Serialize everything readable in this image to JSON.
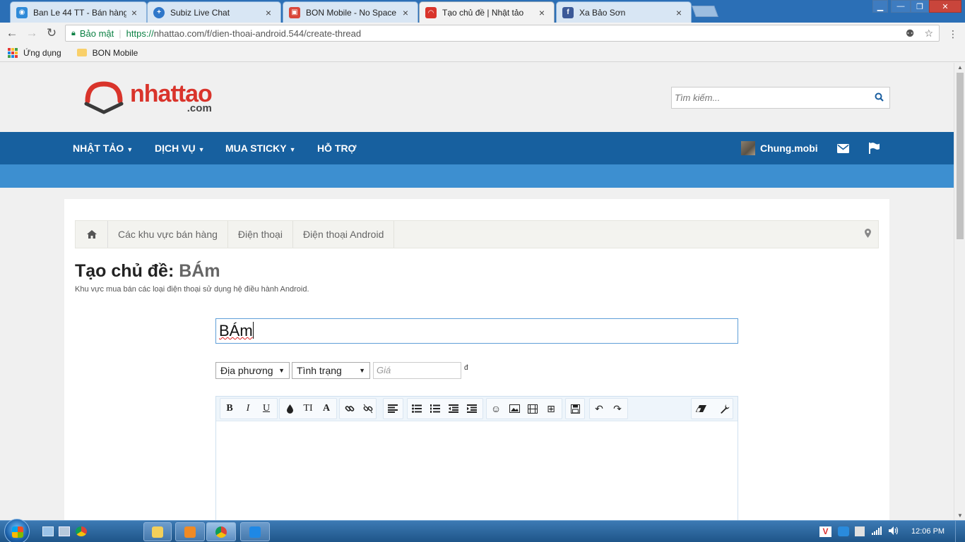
{
  "browser": {
    "tabs": [
      {
        "title": "Ban Le 44 TT - Bán hàng",
        "icon_color": "#2e8ad8",
        "active": false
      },
      {
        "title": "Subiz Live Chat",
        "icon_color": "#2f77c9",
        "active": false
      },
      {
        "title": "BON Mobile - No Space",
        "icon_color": "#d9473a",
        "active": false
      },
      {
        "title": "Tạo chủ đề | Nhật tảo",
        "icon_color": "#d9342b",
        "active": true
      },
      {
        "title": "Xa Bảo Sơn",
        "icon_color": "#3b5998",
        "active": false
      }
    ],
    "secure_label": "Bảo mật",
    "url_scheme": "https://",
    "url_rest": "nhattao.com/f/dien-thoai-android.544/create-thread",
    "bookmarks": {
      "apps_label": "Ứng dụng",
      "folder_label": "BON Mobile"
    }
  },
  "site": {
    "logo_main": "nhattao",
    "logo_sub": ".com",
    "search_placeholder": "Tìm kiếm...",
    "nav": {
      "items": [
        "NHẬT TẢO",
        "DỊCH VỤ",
        "MUA STICKY",
        "HỖ TRỢ"
      ],
      "username": "Chung.mobi"
    },
    "breadcrumb": [
      "Các khu vực bán hàng",
      "Điện thoại",
      "Điện thoại Android"
    ],
    "page_title_prefix": "Tạo chủ đề:",
    "page_title_value": "BÁm",
    "page_description": "Khu vực mua bán các loại điện thoại sử dụng hệ điều hành Android.",
    "form": {
      "title_value": "BÁm",
      "location_select": "Địa phương",
      "condition_select": "Tình trạng",
      "price_placeholder": "Giá",
      "currency": "đ"
    }
  },
  "taskbar": {
    "clock": "12:06 PM"
  },
  "colors": {
    "brand_red": "#d9342b",
    "nav_blue": "#17609f",
    "subbar_blue": "#3d8fd0"
  }
}
